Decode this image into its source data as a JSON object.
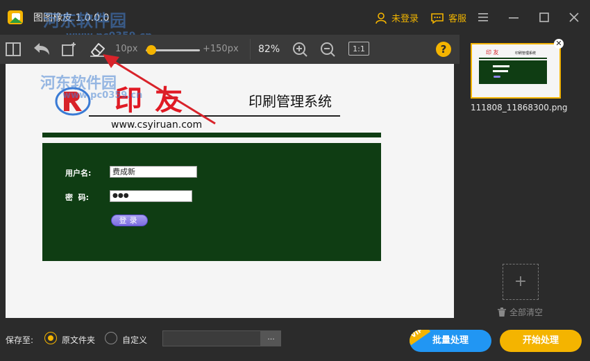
{
  "app": {
    "title": "图图橡皮 1.0.0.0"
  },
  "header": {
    "login_label": "未登录",
    "service_label": "客服"
  },
  "toolbar": {
    "brush_min_label": "10px",
    "brush_max_label": "+150px",
    "brush_level": 0.1,
    "zoom_label": "82%",
    "actual_size_label": "1:1",
    "help_label": "?"
  },
  "document": {
    "brand": "印友",
    "system_title": "印刷管理系统",
    "url": "www.csyiruan.com",
    "username_label": "用户名:",
    "username_value": "费成新",
    "password_label": "密  码:",
    "password_value": "●●●",
    "login_button": "登录"
  },
  "watermark": {
    "name": "河东软件园",
    "site": "www.pc0359.cn"
  },
  "files": [
    {
      "name": "111808_11868300.png"
    }
  ],
  "right_panel": {
    "add_label": "+",
    "clear_all_label": "全部清空"
  },
  "bottom": {
    "save_to_label": "保存至:",
    "option_original": "原文件夹",
    "option_custom": "自定义",
    "selected_option": "原文件夹",
    "path_value": "",
    "browse_label": "...",
    "batch_label": "批量处理",
    "vip_label": "VIP",
    "start_label": "开始处理"
  },
  "colors": {
    "accent": "#f4b400",
    "batch": "#2196f3",
    "arrow": "#d8232a",
    "doc_green": "#0f3d13"
  }
}
